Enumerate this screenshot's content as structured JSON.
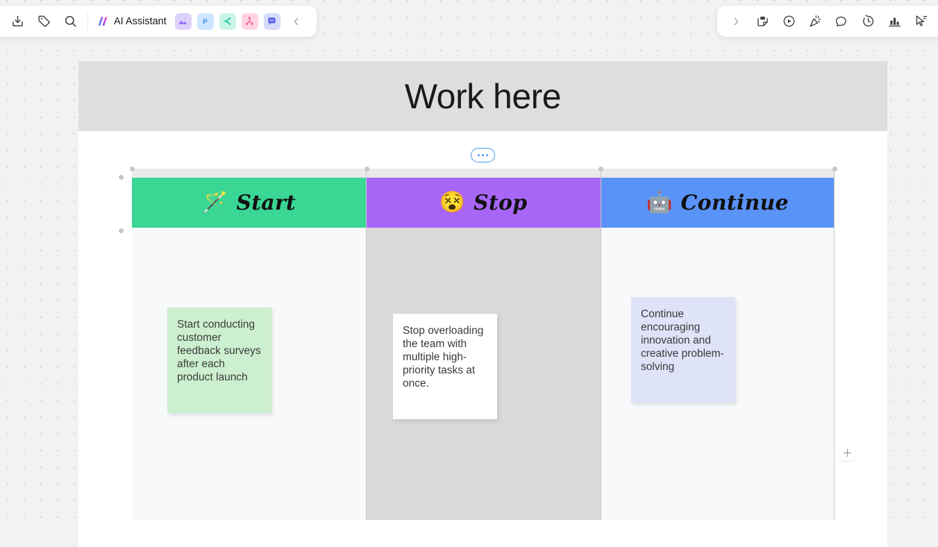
{
  "toolbar_left": {
    "buttons": [
      {
        "name": "import-icon",
        "title": "Import"
      },
      {
        "name": "tag-icon",
        "title": "Tag"
      },
      {
        "name": "search-icon",
        "title": "Search"
      }
    ],
    "ai_assistant": {
      "label": "AI Assistant",
      "icon": "ai-logo-icon"
    },
    "apps": [
      {
        "name": "image-magic-icon",
        "title": "Image",
        "color": "#ddd2fb"
      },
      {
        "name": "prototype-icon",
        "title": "Prototype",
        "color": "#cfe6ff"
      },
      {
        "name": "diagram-icon",
        "title": "Diagram",
        "color": "#c9f5e8"
      },
      {
        "name": "mindmap-icon",
        "title": "Mind map",
        "color": "#ffd4e2"
      },
      {
        "name": "comment-app-icon",
        "title": "Comments",
        "color": "#d7dbfb"
      }
    ],
    "collapse_label": "‹"
  },
  "toolbar_right": {
    "expand_label": "›",
    "buttons": [
      {
        "name": "sticky-note-icon",
        "title": "Sticky note"
      },
      {
        "name": "play-circle-icon",
        "title": "Present"
      },
      {
        "name": "celebrate-icon",
        "title": "Celebrate"
      },
      {
        "name": "comment-icon",
        "title": "Comment"
      },
      {
        "name": "timer-icon",
        "title": "Timer"
      },
      {
        "name": "vote-chart-icon",
        "title": "Voting"
      },
      {
        "name": "cursor-share-icon",
        "title": "Bring to me"
      }
    ]
  },
  "board": {
    "title": "Work here",
    "context_menu_label": "•••",
    "add_row_label": "+",
    "table": {
      "columns": [
        {
          "id": "start",
          "emoji": "🪄",
          "emoji_name": "magic-wand-emoji",
          "label": "Start",
          "header_color": "#3ad694",
          "body_color": "#f8f9fa",
          "note": {
            "text": "Start conducting customer feedback surveys after each product launch",
            "color": "#ccf0cf"
          }
        },
        {
          "id": "stop",
          "emoji": "😵",
          "emoji_name": "dizzy-robot-emoji",
          "label": "Stop",
          "header_color": "#a866f7",
          "body_color": "#d9d9d9",
          "note": {
            "text": "Stop overloading the team with multiple high-priority tasks at once.",
            "color": "#ffffff"
          }
        },
        {
          "id": "continue",
          "emoji": "🤖",
          "emoji_name": "robot-emoji",
          "label": "Continue",
          "header_color": "#5a93f7",
          "body_color": "#f8f9fa",
          "note": {
            "text": "Continue encouraging innovation and creative problem-solving",
            "color": "#dfe3f8"
          }
        }
      ]
    }
  }
}
